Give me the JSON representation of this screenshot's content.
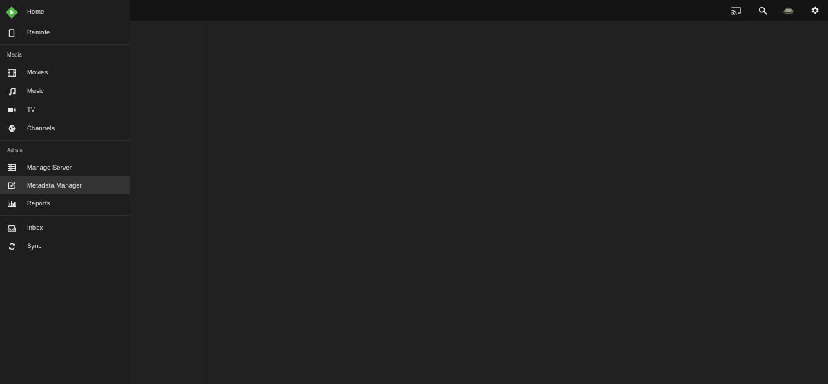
{
  "drawer": {
    "top_items": [
      {
        "label": "Home",
        "icon": "app-logo-icon"
      },
      {
        "label": "Remote",
        "icon": "tablet-icon"
      }
    ],
    "media_header": "Media",
    "media_items": [
      {
        "label": "Movies",
        "icon": "film-icon"
      },
      {
        "label": "Music",
        "icon": "music-note-icon"
      },
      {
        "label": "TV",
        "icon": "video-camera-icon"
      },
      {
        "label": "Channels",
        "icon": "globe-icon"
      }
    ],
    "admin_header": "Admin",
    "admin_items": [
      {
        "label": "Manage Server",
        "icon": "server-icon"
      },
      {
        "label": "Metadata Manager",
        "icon": "edit-icon",
        "active": true
      },
      {
        "label": "Reports",
        "icon": "bar-chart-icon"
      }
    ],
    "bottom_items": [
      {
        "label": "Inbox",
        "icon": "inbox-icon"
      },
      {
        "label": "Sync",
        "icon": "sync-icon"
      }
    ]
  },
  "topbar": {
    "actions": [
      "cast-icon",
      "search-icon",
      "user-avatar",
      "gear-icon"
    ]
  },
  "colors": {
    "logo_green": "#52b54b",
    "topbar_bg": "#141414",
    "drawer_bg": "#1e1e1e",
    "active_item_bg": "#333333"
  }
}
